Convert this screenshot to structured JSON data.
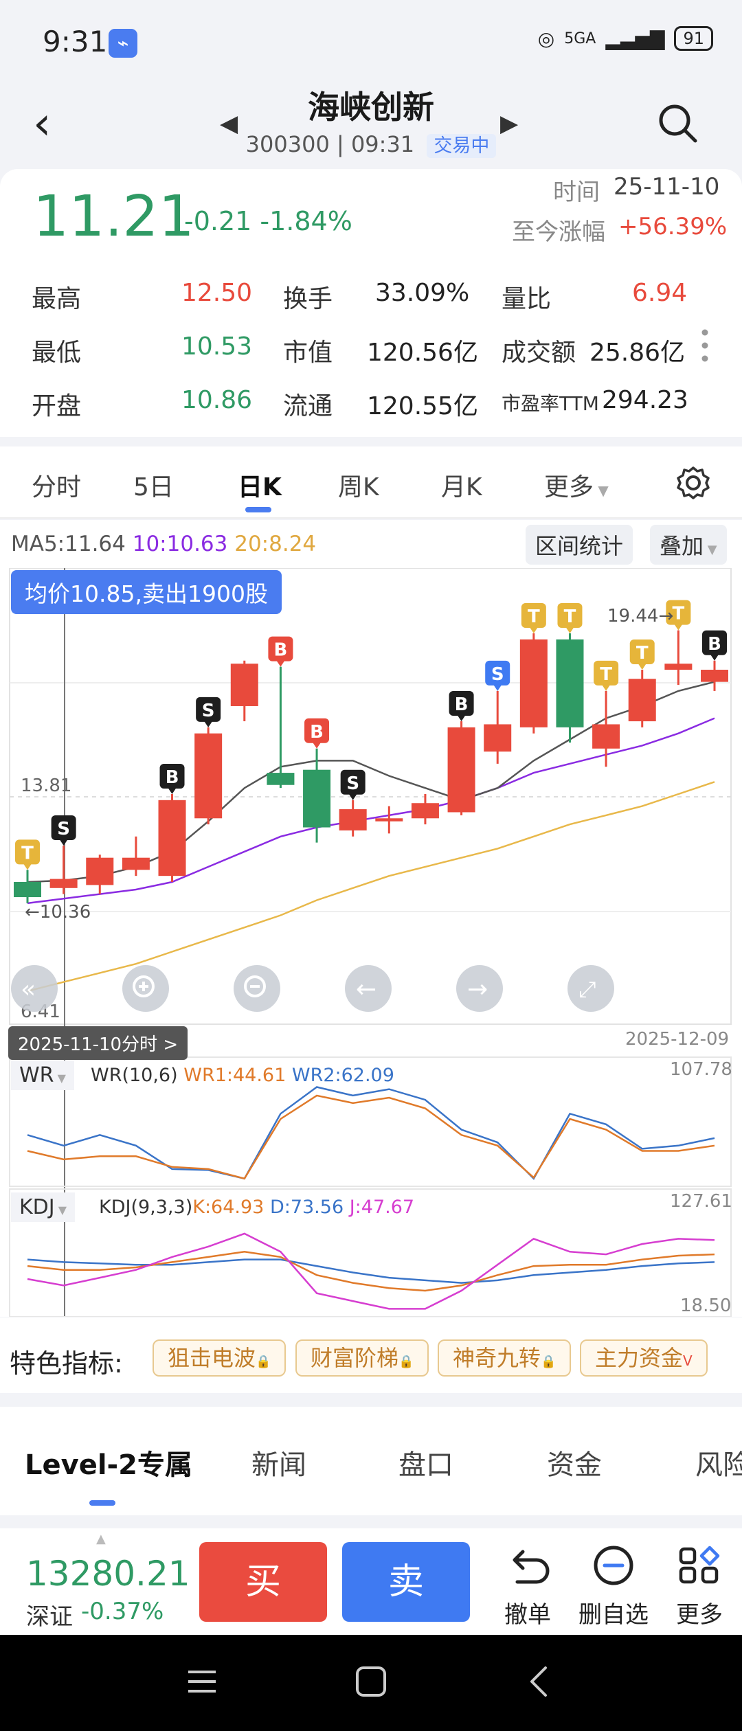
{
  "status": {
    "time": "9:31",
    "network": "5GA",
    "battery": "91"
  },
  "header": {
    "title": "海峡创新",
    "code": "300300",
    "time": "09:31",
    "state": "交易中"
  },
  "quote": {
    "price": "11.21",
    "change": "-0.21 -1.84%",
    "time_label": "时间",
    "time_value": "25-11-10",
    "gain_label": "至今涨幅",
    "gain_value": "+56.39%",
    "stats": [
      {
        "label": "最高",
        "value": "12.50"
      },
      {
        "label": "换手",
        "value": "33.09%"
      },
      {
        "label": "量比",
        "value": "6.94"
      },
      {
        "label": "最低",
        "value": "10.53"
      },
      {
        "label": "市值",
        "value": "120.56亿"
      },
      {
        "label": "成交额",
        "value": "25.86亿"
      },
      {
        "label": "开盘",
        "value": "10.86"
      },
      {
        "label": "流通",
        "value": "120.55亿"
      },
      {
        "label": "市盈率TTM",
        "value": "294.23"
      }
    ]
  },
  "tabs": [
    "分时",
    "5日",
    "日K",
    "周K",
    "月K",
    "更多"
  ],
  "chart": {
    "ma5": "MA5:11.64",
    "ma10": "10:10.63",
    "ma20": "20:8.24",
    "range_stats": "区间统计",
    "overlay": "叠加",
    "avg_banner": "均价10.85,卖出1900股",
    "price_top_label": "19.44",
    "price_mid_label": "13.81",
    "price_low_label": "10.36",
    "price_bottom_label": "6.41",
    "date_chip": "2025-11-10分时 >",
    "date_right": "2025-12-09",
    "colors": {
      "up": "#e84a3c",
      "down": "#2f9a64",
      "ma5": "#555555",
      "ma10": "#8a2be2",
      "ma20": "#e8b84a"
    },
    "wr": {
      "label": "WR",
      "params": "WR(10,6)",
      "wr1": "WR1:44.61",
      "wr2": "WR2:62.09",
      "max": "107.78"
    },
    "kdj": {
      "label": "KDJ",
      "params": "KDJ(9,3,3)",
      "k": "K:64.93",
      "d": "D:73.56",
      "j": "J:47.67",
      "max": "127.61",
      "min": "18.50"
    }
  },
  "chart_data": {
    "type": "candlestick",
    "ylim": [
      6.41,
      21.0
    ],
    "candles": [
      {
        "o": 11.1,
        "c": 10.6,
        "h": 11.5,
        "l": 10.4,
        "mark": "T"
      },
      {
        "o": 10.9,
        "c": 11.2,
        "h": 12.3,
        "l": 10.7,
        "mark": "S"
      },
      {
        "o": 11.0,
        "c": 11.9,
        "h": 12.0,
        "l": 10.7
      },
      {
        "o": 11.5,
        "c": 11.9,
        "h": 12.6,
        "l": 11.3
      },
      {
        "o": 11.3,
        "c": 13.8,
        "h": 14.0,
        "l": 11.1,
        "mark": "B"
      },
      {
        "o": 13.2,
        "c": 16.0,
        "h": 16.2,
        "l": 13.0,
        "mark": "S"
      },
      {
        "o": 16.9,
        "c": 18.3,
        "h": 18.4,
        "l": 16.4
      },
      {
        "o": 14.7,
        "c": 14.3,
        "h": 18.2,
        "l": 14.2,
        "mark": "B"
      },
      {
        "o": 14.8,
        "c": 12.9,
        "h": 15.5,
        "l": 12.4,
        "mark": "B"
      },
      {
        "o": 12.8,
        "c": 13.5,
        "h": 13.8,
        "l": 12.6,
        "mark": "S"
      },
      {
        "o": 13.1,
        "c": 13.2,
        "h": 13.6,
        "l": 12.7
      },
      {
        "o": 13.2,
        "c": 13.7,
        "h": 14.0,
        "l": 13.0
      },
      {
        "o": 13.4,
        "c": 16.2,
        "h": 16.4,
        "l": 13.3,
        "mark": "B"
      },
      {
        "o": 15.4,
        "c": 16.3,
        "h": 17.4,
        "l": 15.0,
        "mark": "S"
      },
      {
        "o": 16.2,
        "c": 19.1,
        "h": 19.3,
        "l": 16.0,
        "mark": "T"
      },
      {
        "o": 19.1,
        "c": 16.2,
        "h": 19.3,
        "l": 15.7,
        "mark": "T"
      },
      {
        "o": 15.5,
        "c": 16.3,
        "h": 17.4,
        "l": 14.9,
        "mark": "T"
      },
      {
        "o": 16.4,
        "c": 17.8,
        "h": 18.1,
        "l": 16.2,
        "mark": "T"
      },
      {
        "o": 18.1,
        "c": 18.3,
        "h": 19.4,
        "l": 17.6,
        "mark": "T"
      },
      {
        "o": 17.7,
        "c": 18.1,
        "h": 18.4,
        "l": 17.4,
        "mark": "B"
      }
    ],
    "ma5": [
      11.1,
      11.15,
      11.3,
      11.6,
      12.1,
      13.1,
      14.2,
      14.9,
      15.1,
      15.1,
      14.6,
      14.2,
      13.8,
      14.2,
      15.1,
      15.8,
      16.5,
      16.9,
      17.4,
      17.7
    ],
    "ma10": [
      10.4,
      10.55,
      10.7,
      10.85,
      11.1,
      11.6,
      12.1,
      12.6,
      12.9,
      13.1,
      13.3,
      13.5,
      13.8,
      14.2,
      14.7,
      15.0,
      15.3,
      15.6,
      16.0,
      16.5
    ],
    "ma20": [
      7.5,
      7.8,
      8.1,
      8.4,
      8.8,
      9.2,
      9.6,
      10.0,
      10.5,
      10.9,
      11.3,
      11.6,
      11.9,
      12.2,
      12.6,
      13.0,
      13.3,
      13.6,
      14.0,
      14.4
    ],
    "wr1": [
      70,
      78,
      75,
      75,
      85,
      87,
      96,
      40,
      18,
      25,
      20,
      30,
      55,
      65,
      95,
      40,
      50,
      70,
      70,
      65
    ],
    "wr2": [
      55,
      65,
      55,
      65,
      87,
      88,
      96,
      35,
      10,
      18,
      12,
      22,
      50,
      62,
      96,
      35,
      45,
      68,
      65,
      58
    ],
    "kdj_k": [
      55,
      52,
      52,
      54,
      58,
      62,
      66,
      62,
      48,
      42,
      38,
      36,
      40,
      48,
      55,
      56,
      56,
      60,
      63,
      64
    ],
    "kdj_d": [
      60,
      58,
      57,
      56,
      56,
      58,
      60,
      60,
      55,
      50,
      46,
      44,
      42,
      44,
      48,
      50,
      52,
      55,
      57,
      58
    ],
    "kdj_j": [
      45,
      40,
      46,
      52,
      62,
      70,
      80,
      66,
      34,
      28,
      22,
      22,
      36,
      56,
      76,
      66,
      64,
      72,
      76,
      75
    ]
  },
  "features": {
    "label": "特色指标:",
    "chips": [
      "狙击电波",
      "财富阶梯",
      "神奇九转",
      "主力资金"
    ]
  },
  "level2_tabs": [
    "Level-2专属",
    "新闻",
    "盘口",
    "资金",
    "风险"
  ],
  "tradebar": {
    "index_value": "13280.21",
    "index_name": "深证",
    "index_change": "-0.37%",
    "buy": "买",
    "sell": "卖",
    "cancel": "撤单",
    "remove_watch": "删自选",
    "more": "更多"
  }
}
